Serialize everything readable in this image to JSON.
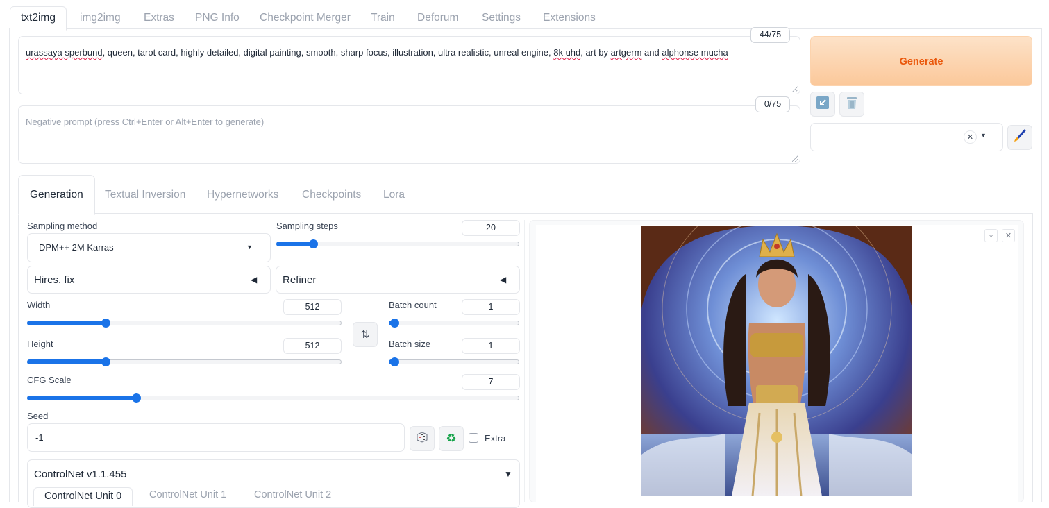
{
  "top_tabs": [
    "txt2img",
    "img2img",
    "Extras",
    "PNG Info",
    "Checkpoint Merger",
    "Train",
    "Deforum",
    "Settings",
    "Extensions"
  ],
  "prompt": {
    "text_parts": [
      {
        "t": "urassaya sperbund",
        "squig": true
      },
      {
        "t": ", queen, tarot card, highly detailed, digital painting, smooth, sharp focus, illustration, ultra realistic, unreal engine, ",
        "squig": false
      },
      {
        "t": "8k uhd",
        "squig": true
      },
      {
        "t": ", art by ",
        "squig": false
      },
      {
        "t": "artgerm",
        "squig": true
      },
      {
        "t": " and ",
        "squig": false
      },
      {
        "t": "alphonse mucha",
        "squig": true
      }
    ],
    "token_count": "44/75"
  },
  "negative_prompt": {
    "placeholder": "Negative prompt (press Ctrl+Enter or Alt+Enter to generate)",
    "token_count": "0/75"
  },
  "generate_label": "Generate",
  "sub_tabs": [
    "Generation",
    "Textual Inversion",
    "Hypernetworks",
    "Checkpoints",
    "Lora"
  ],
  "sampling": {
    "method_label": "Sampling method",
    "method_value": "DPM++ 2M Karras",
    "steps_label": "Sampling steps",
    "steps_value": "20",
    "steps_fraction": 0.13
  },
  "hires_fix_label": "Hires. fix",
  "refiner_label": "Refiner",
  "width": {
    "label": "Width",
    "value": "512",
    "fraction": 0.237
  },
  "height": {
    "label": "Height",
    "value": "512",
    "fraction": 0.237
  },
  "batch_count": {
    "label": "Batch count",
    "value": "1",
    "fraction": 0.0
  },
  "batch_size": {
    "label": "Batch size",
    "value": "1",
    "fraction": 0.0
  },
  "cfg": {
    "label": "CFG Scale",
    "value": "7",
    "fraction": 0.213
  },
  "seed": {
    "label": "Seed",
    "value": "-1",
    "extra_label": "Extra"
  },
  "controlnet": {
    "title": "ControlNet v1.1.455",
    "tabs": [
      "ControlNet Unit 0",
      "ControlNet Unit 1",
      "ControlNet Unit 2"
    ]
  },
  "icons": {
    "swap": "swap-dimensions-icon",
    "dice": "dice-icon",
    "recycle": "recycle-icon",
    "trash": "trash-icon",
    "arrow": "paste-arrow-icon",
    "brush": "paintbrush-icon"
  },
  "colors": {
    "accent": "#1a73e8",
    "generate_text": "#ea580c"
  }
}
